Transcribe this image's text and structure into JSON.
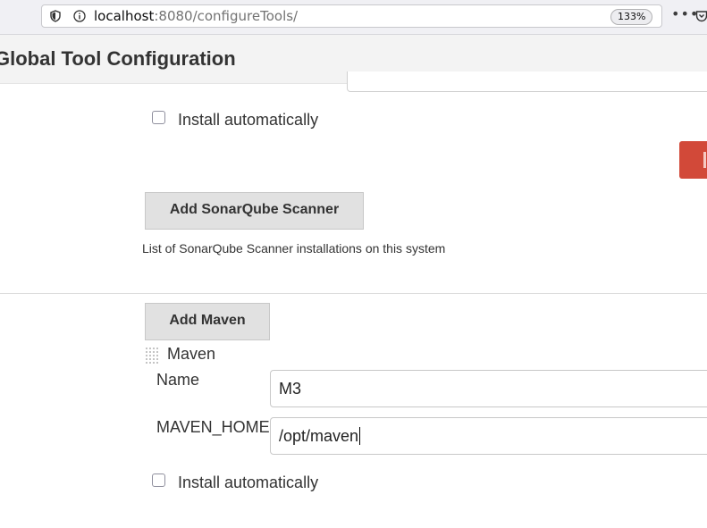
{
  "browser": {
    "url_host": "localhost",
    "url_rest": ":8080/configureTools/",
    "zoom": "133%",
    "more": "•••"
  },
  "page": {
    "title": "Global Tool Configuration"
  },
  "sonarqube": {
    "install_automatically_label": "Install automatically",
    "install_automatically_checked": false,
    "add_button_label": "Add SonarQube Scanner",
    "help_text": "List of SonarQube Scanner installations on this system"
  },
  "maven": {
    "add_button_label": "Add Maven",
    "installation_header": "Maven",
    "name_label": "Name",
    "name_value": "M3",
    "home_label": "MAVEN_HOME",
    "home_value": "/opt/maven",
    "install_automatically_label": "Install automatically",
    "install_automatically_checked": false
  },
  "colors": {
    "delete_button": "#d24939",
    "button_bg": "#e1e1e1",
    "header_bg": "#f3f3f3"
  },
  "icons": [
    "shield-icon",
    "info-icon",
    "more-icon",
    "pocket-icon",
    "drag-handle-icon"
  ]
}
